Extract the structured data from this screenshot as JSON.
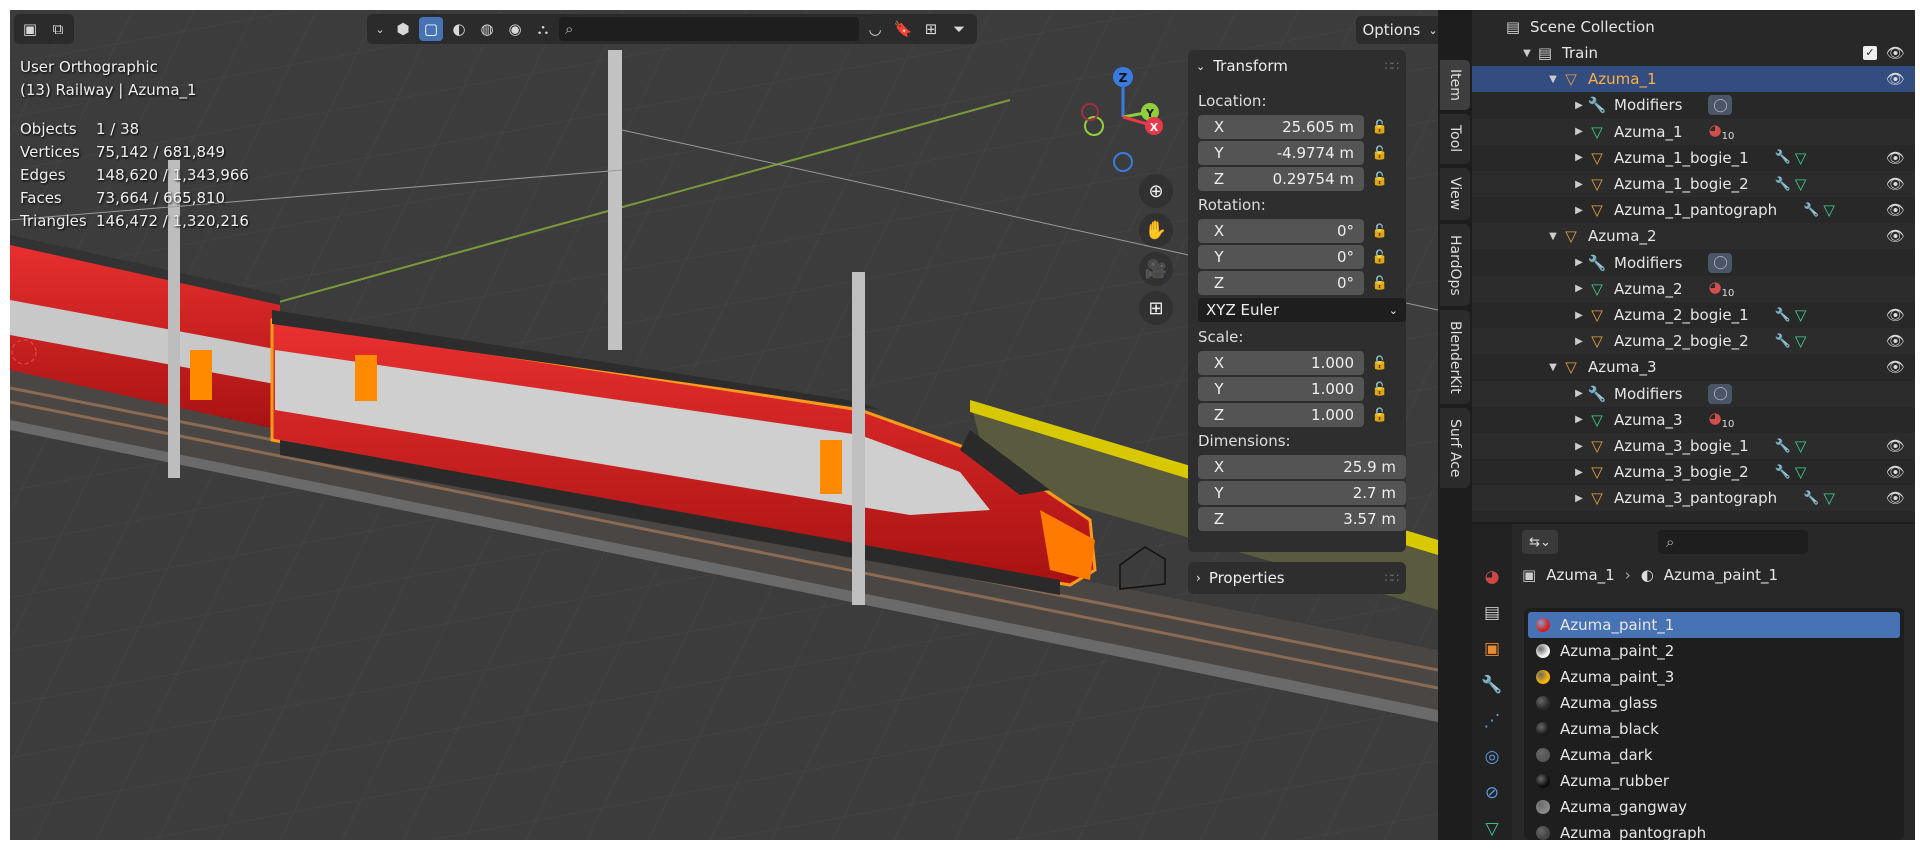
{
  "viewport": {
    "view_name": "User Orthographic",
    "collection_line": "(13) Railway | Azuma_1",
    "stats": [
      {
        "label": "Objects",
        "value": "1 / 38"
      },
      {
        "label": "Vertices",
        "value": "75,142 / 681,849"
      },
      {
        "label": "Edges",
        "value": "148,620 / 1,343,966"
      },
      {
        "label": "Faces",
        "value": "73,664 / 665,810"
      },
      {
        "label": "Triangles",
        "value": "146,472 / 1,320,216"
      }
    ],
    "options_label": "Options",
    "gizmo": {
      "z": "Z",
      "y": "Y",
      "x": "X"
    }
  },
  "npanel": {
    "transform_title": "Transform",
    "location_label": "Location:",
    "location": [
      {
        "axis": "X",
        "value": "25.605 m"
      },
      {
        "axis": "Y",
        "value": "-4.9774 m"
      },
      {
        "axis": "Z",
        "value": "0.29754 m"
      }
    ],
    "rotation_label": "Rotation:",
    "rotation": [
      {
        "axis": "X",
        "value": "0°"
      },
      {
        "axis": "Y",
        "value": "0°"
      },
      {
        "axis": "Z",
        "value": "0°"
      }
    ],
    "rotation_mode": "XYZ Euler",
    "scale_label": "Scale:",
    "scale": [
      {
        "axis": "X",
        "value": "1.000"
      },
      {
        "axis": "Y",
        "value": "1.000"
      },
      {
        "axis": "Z",
        "value": "1.000"
      }
    ],
    "dimensions_label": "Dimensions:",
    "dimensions": [
      {
        "axis": "X",
        "value": "25.9 m"
      },
      {
        "axis": "Y",
        "value": "2.7 m"
      },
      {
        "axis": "Z",
        "value": "3.57 m"
      }
    ],
    "properties_title": "Properties"
  },
  "sidetabs": [
    "Item",
    "Tool",
    "View",
    "HardOps",
    "BlenderKit",
    "Surf Ace"
  ],
  "outliner": {
    "root": "Scene Collection",
    "rows": [
      {
        "name": "Train",
        "type": "collection",
        "depth": 1
      },
      {
        "name": "Azuma_1",
        "type": "object",
        "depth": 2
      },
      {
        "name": "Modifiers",
        "type": "modifiers",
        "depth": 3
      },
      {
        "name": "Azuma_1",
        "type": "mesh",
        "depth": 3,
        "badge": "10"
      },
      {
        "name": "Azuma_1_bogie_1",
        "type": "object",
        "depth": 3
      },
      {
        "name": "Azuma_1_bogie_2",
        "type": "object",
        "depth": 3
      },
      {
        "name": "Azuma_1_pantograph",
        "type": "object",
        "depth": 3
      },
      {
        "name": "Azuma_2",
        "type": "object",
        "depth": 2
      },
      {
        "name": "Modifiers",
        "type": "modifiers",
        "depth": 3
      },
      {
        "name": "Azuma_2",
        "type": "mesh",
        "depth": 3,
        "badge": "10"
      },
      {
        "name": "Azuma_2_bogie_1",
        "type": "object",
        "depth": 3
      },
      {
        "name": "Azuma_2_bogie_2",
        "type": "object",
        "depth": 3
      },
      {
        "name": "Azuma_3",
        "type": "object",
        "depth": 2
      },
      {
        "name": "Modifiers",
        "type": "modifiers",
        "depth": 3
      },
      {
        "name": "Azuma_3",
        "type": "mesh",
        "depth": 3,
        "badge": "10"
      },
      {
        "name": "Azuma_3_bogie_1",
        "type": "object",
        "depth": 3
      },
      {
        "name": "Azuma_3_bogie_2",
        "type": "object",
        "depth": 3
      },
      {
        "name": "Azuma_3_pantograph",
        "type": "object",
        "depth": 3
      }
    ]
  },
  "properties": {
    "object_name": "Azuma_1",
    "material_name": "Azuma_paint_1",
    "materials": [
      {
        "name": "Azuma_paint_1",
        "color": "#d62020"
      },
      {
        "name": "Azuma_paint_2",
        "color": "#f2f2f2"
      },
      {
        "name": "Azuma_paint_3",
        "color": "#f5b400"
      },
      {
        "name": "Azuma_glass",
        "color": "#2a2a2a"
      },
      {
        "name": "Azuma_black",
        "color": "#1a1a1a"
      },
      {
        "name": "Azuma_dark",
        "color": "#555555"
      },
      {
        "name": "Azuma_rubber",
        "color": "#0d0d0d"
      },
      {
        "name": "Azuma_gangway",
        "color": "#888888"
      },
      {
        "name": "Azuma_pantograph",
        "color": "#444444"
      }
    ]
  },
  "colors": {
    "accent": "#4772b3",
    "selection_outline": "#ff9a1a",
    "train_red": "#d42222",
    "object_orange": "#e8a040",
    "mesh_green": "#3fcf8e",
    "modifier_blue": "#6f9fe0"
  }
}
